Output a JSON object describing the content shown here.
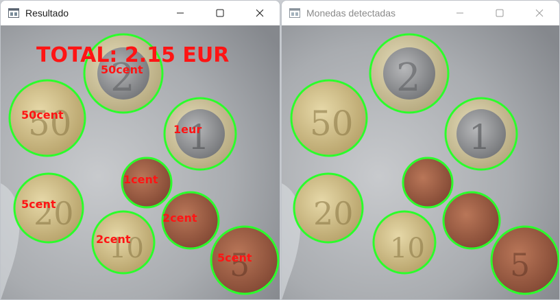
{
  "windows": [
    {
      "title": "Resultado",
      "active": true,
      "image": {
        "total_label": "TOTAL: 2.15 EUR",
        "coins": [
          {
            "label": "50cent"
          },
          {
            "label": "50cent"
          },
          {
            "label": "1eur"
          },
          {
            "label": "1cent"
          },
          {
            "label": "5cent"
          },
          {
            "label": "2cent"
          },
          {
            "label": "2cent"
          },
          {
            "label": "5cent"
          }
        ]
      }
    },
    {
      "title": "Monedas detectadas",
      "active": false,
      "image": {
        "coins_count": 8
      }
    }
  ],
  "icons": {
    "app": "app-window-icon",
    "minimize": "minimize-icon",
    "maximize": "maximize-icon",
    "close": "close-icon"
  },
  "colors": {
    "detection_circle": "#2bff2b",
    "annotation_text": "#ff1414",
    "gold_coin": "#c9b681",
    "bimetal_outer": "#cfc49a",
    "bimetal_inner": "#8b8c8e",
    "copper_coin": "#9b5d44"
  }
}
